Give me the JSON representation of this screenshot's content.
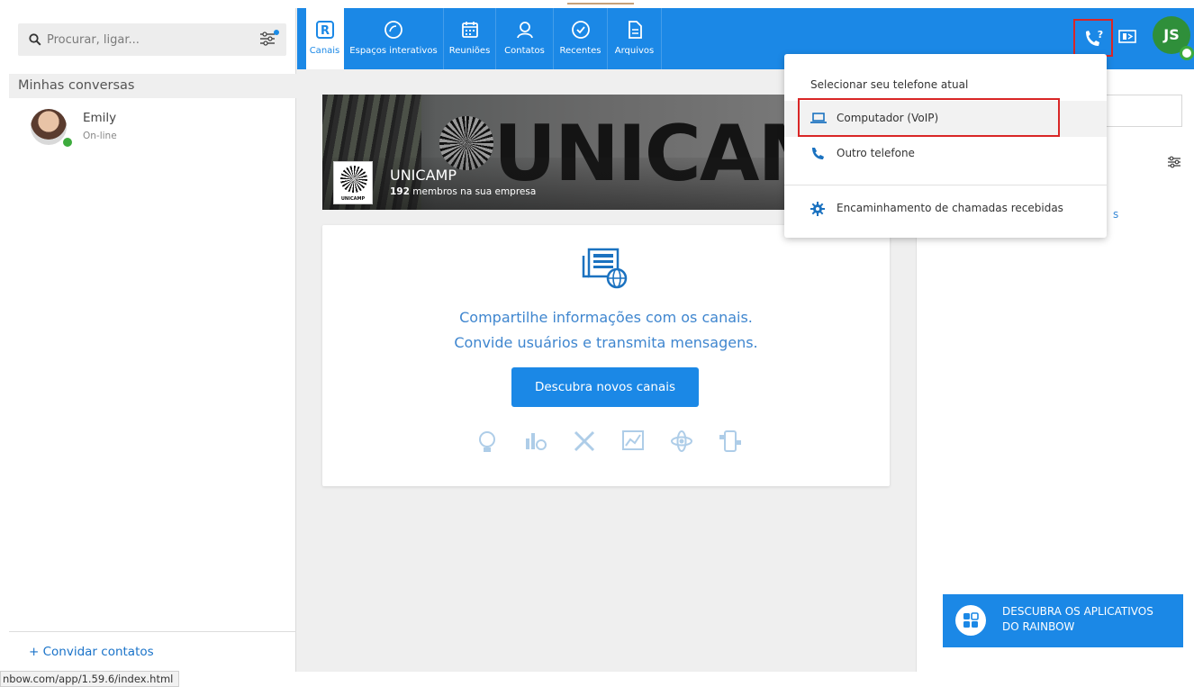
{
  "search": {
    "placeholder": "Procurar, ligar..."
  },
  "sidebar": {
    "section_title": "Minhas conversas",
    "contacts": [
      {
        "name": "Emily",
        "status": "On-line"
      }
    ],
    "invite_label": "+  Convidar contatos"
  },
  "topnav": {
    "tabs": [
      {
        "label": "Canais",
        "icon": "channels-icon",
        "active": true
      },
      {
        "label": "Espaços interativos",
        "icon": "bubble-icon"
      },
      {
        "label": "Reuniões",
        "icon": "calendar-icon"
      },
      {
        "label": "Contatos",
        "icon": "person-icon"
      },
      {
        "label": "Recentes",
        "icon": "clock-icon"
      },
      {
        "label": "Arquivos",
        "icon": "file-icon"
      }
    ],
    "user_initials": "JS"
  },
  "banner": {
    "big_text": "UNICAMP",
    "title": "UNICAMP",
    "subtitle_count": "192",
    "subtitle_text": " membros na sua empresa",
    "logo_text": "UNICAMP"
  },
  "card": {
    "line1": "Compartilhe informações com os canais.",
    "line2": "Convide usuários e transmita mensagens.",
    "button": "Descubra novos canais"
  },
  "rpanel": {
    "link_fragment": "s",
    "apps_line1": "DESCUBRA OS APLICATIVOS",
    "apps_line2": "DO RAINBOW"
  },
  "dropdown": {
    "header": "Selecionar seu telefone atual",
    "items": [
      {
        "label": "Computador (VoIP)",
        "icon": "laptop-icon"
      },
      {
        "label": "Outro telefone",
        "icon": "phone-icon"
      },
      {
        "label": "Encaminhamento de chamadas recebidas",
        "icon": "gear-icon"
      }
    ]
  },
  "statusbar": {
    "url": "nbow.com/app/1.59.6/index.html"
  },
  "colors": {
    "accent": "#1b88e6",
    "highlight_box": "#d92626",
    "online": "#3dab3d"
  }
}
